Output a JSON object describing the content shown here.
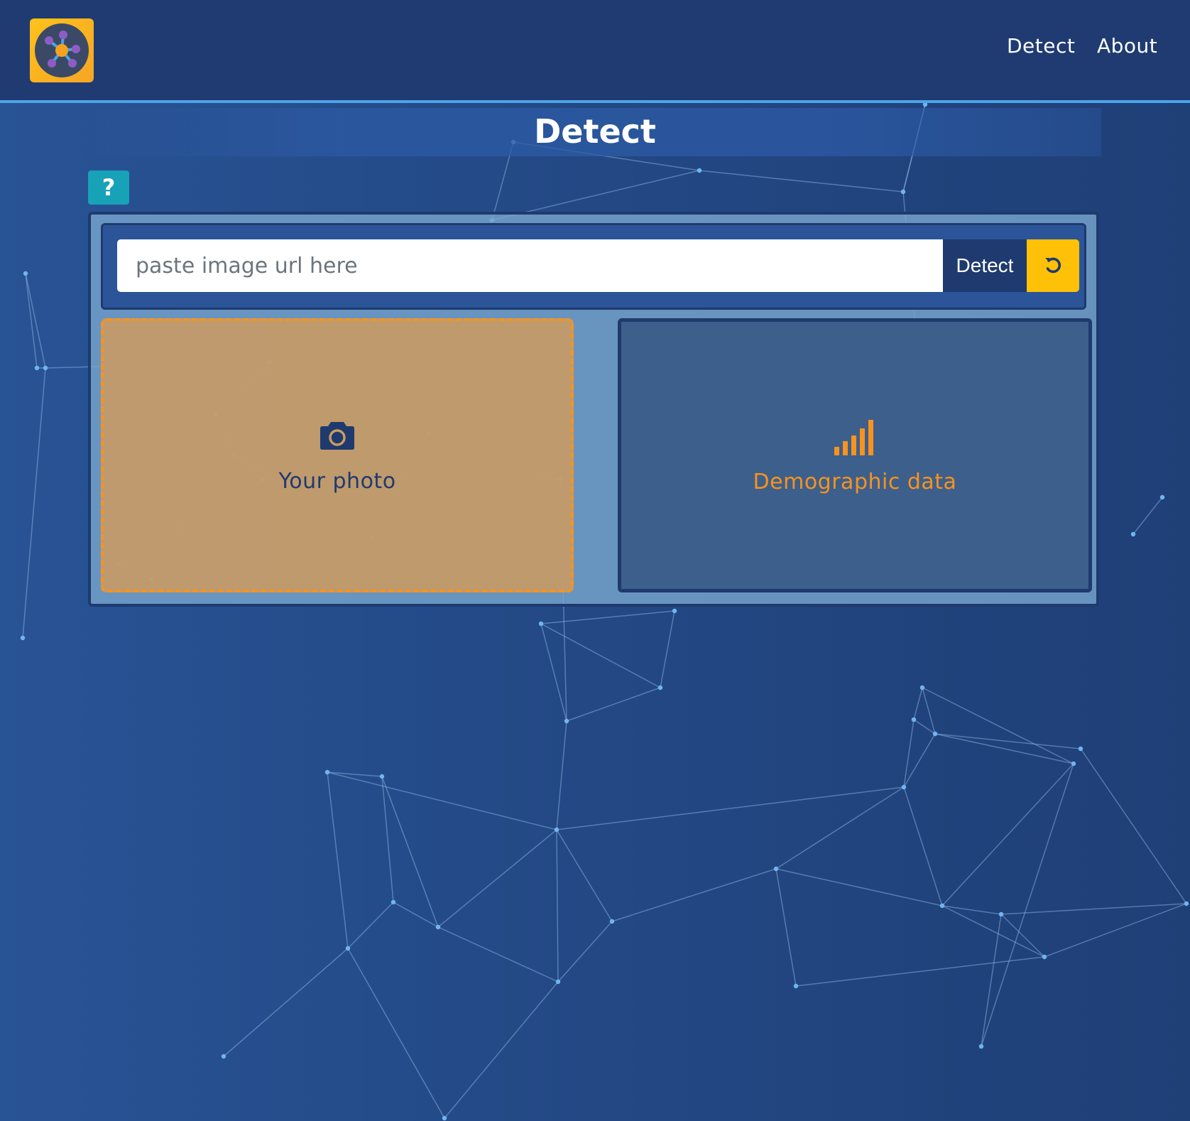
{
  "nav": {
    "links": [
      {
        "label": "Detect"
      },
      {
        "label": "About"
      }
    ]
  },
  "page": {
    "title": "Detect",
    "help_label": "?"
  },
  "url_form": {
    "placeholder": "paste image url here",
    "value": "",
    "detect_label": "Detect",
    "reset_icon": "refresh-icon"
  },
  "photo_panel": {
    "icon": "camera-icon",
    "label": "Your photo"
  },
  "demographic_panel": {
    "icon": "signal-bars-icon",
    "label": "Demographic data"
  },
  "colors": {
    "background": "#234884",
    "navbar": "#1f3b72",
    "accent_blue": "#4ca4e8",
    "accent_orange": "#f7931e",
    "accent_yellow": "#ffc107",
    "help_teal": "#17a2b8",
    "dark_navy": "#1f3a6e"
  }
}
